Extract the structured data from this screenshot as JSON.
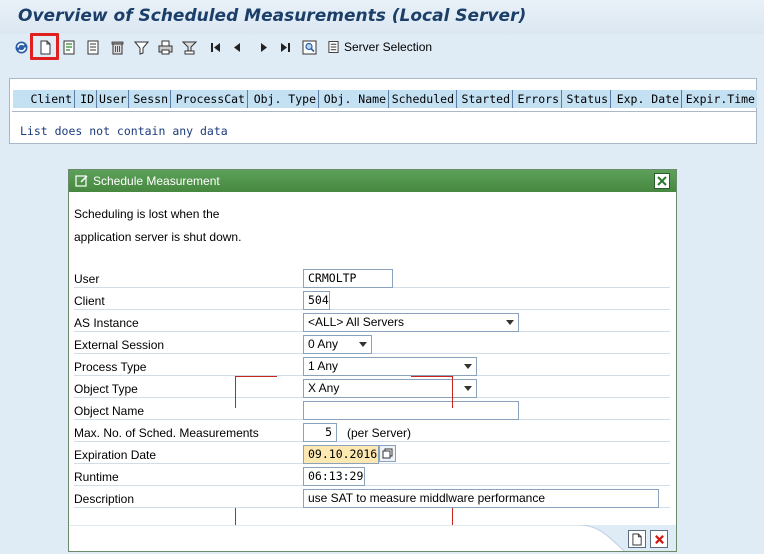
{
  "header": {
    "title": "Overview of Scheduled Measurements (Local Server)"
  },
  "toolbar": {
    "buttons": [
      "refresh-icon",
      "create-icon",
      "change-icon",
      "details-icon",
      "delete-icon",
      "filter-icon",
      "print-icon",
      "export-icon",
      "first-page-icon",
      "previous-icon",
      "next-icon",
      "last-page-icon",
      "find-icon"
    ],
    "server_selection_label": "Server Selection"
  },
  "list": {
    "columns": [
      "Client",
      "ID",
      "User",
      "Sessn",
      "ProcessCat",
      "Obj. Type",
      "Obj. Name",
      "Scheduled",
      "Started",
      "Errors",
      "Status",
      "Exp. Date",
      "Expir.Time"
    ],
    "empty_message": "List does not contain any data"
  },
  "dialog": {
    "title": "Schedule Measurement",
    "note_line1": "Scheduling is lost when the",
    "note_line2": "application server is shut down.",
    "fields": {
      "user": {
        "label": "User",
        "value": "CRMOLTP"
      },
      "client": {
        "label": "Client",
        "value": "504"
      },
      "as_instance": {
        "label": "AS Instance",
        "value": "<ALL> All Servers"
      },
      "external_session": {
        "label": "External Session",
        "value": "0 Any"
      },
      "process_type": {
        "label": "Process Type",
        "value": "1 Any"
      },
      "object_type": {
        "label": "Object Type",
        "value": "X Any"
      },
      "object_name": {
        "label": "Object Name",
        "value": ""
      },
      "max_sched": {
        "label": "Max. No. of Sched. Measurements",
        "value": "5",
        "suffix": "(per Server)"
      },
      "expiration_date": {
        "label": "Expiration Date",
        "value": "09.10.2016"
      },
      "runtime": {
        "label": "Runtime",
        "value": "06:13:29"
      },
      "description": {
        "label": "Description",
        "value": "use SAT to measure middlware performance"
      }
    }
  },
  "colors": {
    "dialog_title_bg": "#4f934a",
    "highlight": "#e0201e",
    "header_bg": "#c4e0f3",
    "date_bg": "#fde8b2"
  }
}
